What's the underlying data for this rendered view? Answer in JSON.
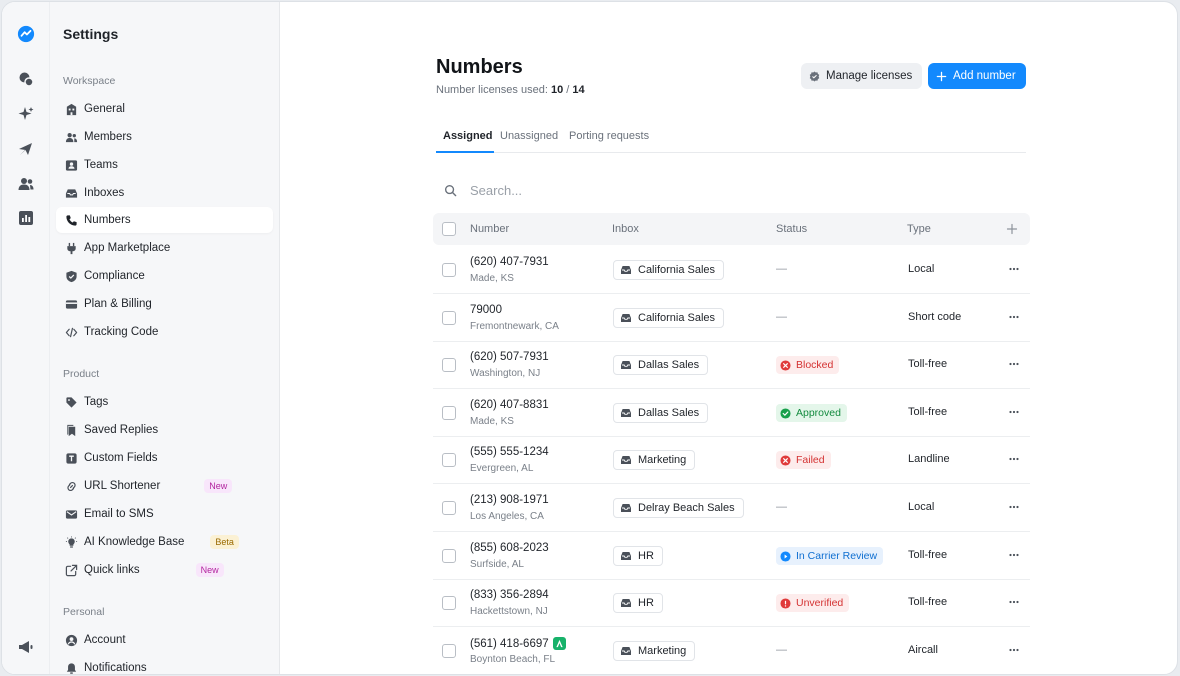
{
  "sidebar": {
    "title": "Settings",
    "sections": [
      {
        "label": "Workspace",
        "items": [
          {
            "label": "General",
            "icon": "building-icon"
          },
          {
            "label": "Members",
            "icon": "members-icon"
          },
          {
            "label": "Teams",
            "icon": "teams-icon"
          },
          {
            "label": "Inboxes",
            "icon": "inbox-icon"
          },
          {
            "label": "Numbers",
            "icon": "phone-icon",
            "active": true
          },
          {
            "label": "App Marketplace",
            "icon": "plug-icon"
          },
          {
            "label": "Compliance",
            "icon": "shield-icon"
          },
          {
            "label": "Plan & Billing",
            "icon": "credit-card-icon"
          },
          {
            "label": "Tracking Code",
            "icon": "code-icon"
          }
        ]
      },
      {
        "label": "Product",
        "items": [
          {
            "label": "Tags",
            "icon": "tag-icon"
          },
          {
            "label": "Saved Replies",
            "icon": "saved-replies-icon"
          },
          {
            "label": "Custom Fields",
            "icon": "custom-fields-icon"
          },
          {
            "label": "URL Shortener",
            "icon": "link-icon",
            "badge": "New"
          },
          {
            "label": "Email to SMS",
            "icon": "email-icon"
          },
          {
            "label": "AI Knowledge Base",
            "icon": "lightbulb-icon",
            "badge": "Beta"
          },
          {
            "label": "Quick links",
            "icon": "external-link-icon",
            "badge": "New"
          }
        ]
      },
      {
        "label": "Personal",
        "items": [
          {
            "label": "Account",
            "icon": "account-icon"
          },
          {
            "label": "Notifications",
            "icon": "bell-icon"
          }
        ]
      }
    ]
  },
  "header": {
    "title": "Numbers",
    "licenses_label": "Number licenses used:",
    "licenses_used": "10",
    "licenses_sep": "/",
    "licenses_total": "14",
    "manage_label": "Manage licenses",
    "add_label": "Add number"
  },
  "tabs": [
    {
      "label": "Assigned",
      "active": true
    },
    {
      "label": "Unassigned"
    },
    {
      "label": "Porting requests"
    }
  ],
  "search": {
    "placeholder": "Search..."
  },
  "table": {
    "columns": {
      "number": "Number",
      "inbox": "Inbox",
      "status": "Status",
      "type": "Type"
    },
    "rows": [
      {
        "number": "(620) 407-7931",
        "location": "Made, KS",
        "inbox": "California Sales",
        "status": "—",
        "type": "Local"
      },
      {
        "number": "79000",
        "location": "Fremontnewark, CA",
        "inbox": "California Sales",
        "status": "—",
        "type": "Short code"
      },
      {
        "number": "(620) 507-7931",
        "location": "Washington, NJ",
        "inbox": "Dallas Sales",
        "status": "Blocked",
        "status_kind": "blocked",
        "type": "Toll-free"
      },
      {
        "number": "(620) 407-8831",
        "location": "Made, KS",
        "inbox": "Dallas Sales",
        "status": "Approved",
        "status_kind": "approved",
        "type": "Toll-free"
      },
      {
        "number": "(555) 555-1234",
        "location": "Evergreen, AL",
        "inbox": "Marketing",
        "status": "Failed",
        "status_kind": "failed",
        "type": "Landline"
      },
      {
        "number": "(213) 908-1971",
        "location": "Los Angeles, CA",
        "inbox": "Delray Beach Sales",
        "status": "—",
        "type": "Local"
      },
      {
        "number": "(855) 608-2023",
        "location": "Surfside, AL",
        "inbox": "HR",
        "status": "In Carrier Review",
        "status_kind": "review",
        "type": "Toll-free"
      },
      {
        "number": "(833) 356-2894",
        "location": "Hackettstown, NJ",
        "inbox": "HR",
        "status": "Unverified",
        "status_kind": "unverified",
        "type": "Toll-free"
      },
      {
        "number": "(561) 418-6697",
        "location": "Boynton Beach, FL",
        "inbox": "Marketing",
        "status": "—",
        "type": "Aircall",
        "aircall_badge": true
      }
    ]
  },
  "colors": {
    "accent": "#1389fd",
    "error": "#d43232",
    "success": "#138a3e",
    "info": "#0f6fd1",
    "aircall": "#17b26a"
  }
}
